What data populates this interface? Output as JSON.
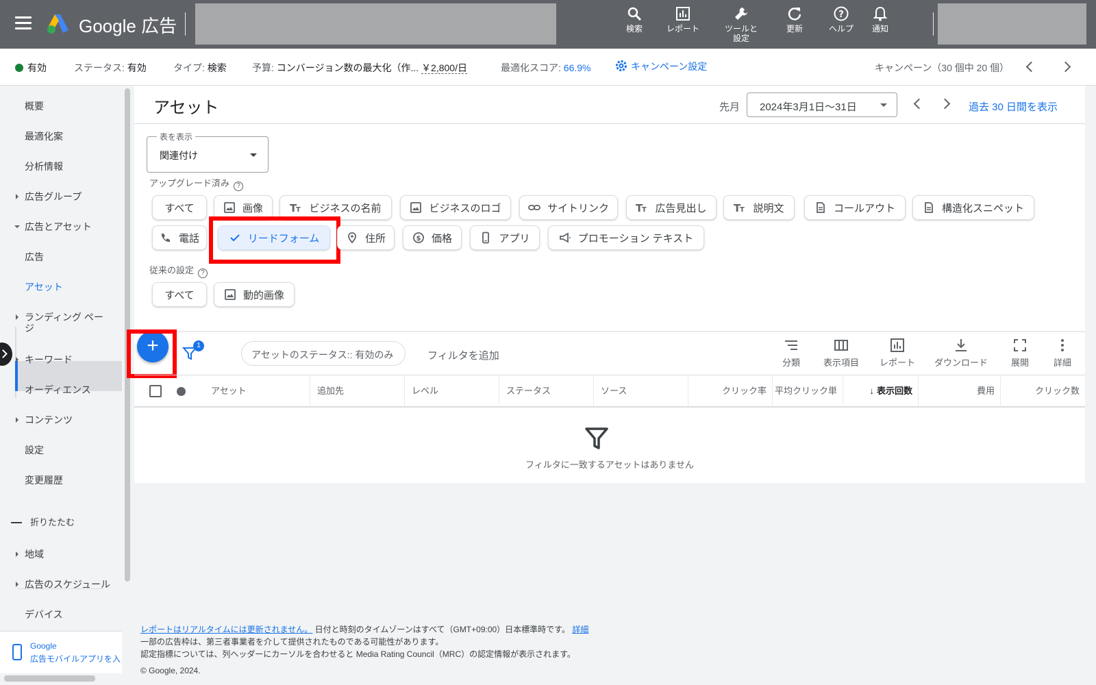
{
  "topbar": {
    "brand": "Google 広告",
    "buttons": [
      {
        "label": "検索",
        "icon": "search-icon"
      },
      {
        "label": "レポート",
        "icon": "report-icon"
      },
      {
        "label": "ツールと",
        "label2": "設定",
        "icon": "wrench-icon"
      },
      {
        "label": "更新",
        "icon": "refresh-icon"
      },
      {
        "label": "ヘルプ",
        "icon": "help-icon"
      },
      {
        "label": "通知",
        "icon": "bell-icon"
      }
    ]
  },
  "summary": {
    "status": "有効",
    "status_label": "ステータス: ",
    "status_value": "有効",
    "type_label": "タイプ: ",
    "type_value": "検索",
    "budget_label": "予算: ",
    "budget_value": "コンバージョン数の最大化（作...",
    "budget_amount": "￥2,800/日",
    "opt_label": "最適化スコア: ",
    "opt_value": "66.9%",
    "campaign_settings": "キャンペーン設定",
    "campaign_count": "キャンペーン（30 個中 20 個）"
  },
  "sidebar": {
    "items": [
      "概要",
      "最適化案",
      "分析情報",
      "広告グループ",
      "広告とアセット",
      "広告",
      "アセット",
      "ランディング ペー",
      "ジ",
      "キーワード",
      "オーディエンス",
      "コンテンツ",
      "設定",
      "変更履歴",
      "折りたたむ",
      "地域",
      "広告のスケジュール",
      "デバイス"
    ],
    "mobile_app_line1": "Google",
    "mobile_app_line2": "広告モバイルアプリを入"
  },
  "main": {
    "title": "アセット",
    "date_label": "先月",
    "date_range": "2024年3月1日〜31日",
    "last30": "過去 30 日間を表示",
    "view_label": "表を表示",
    "view_value": "関連付け",
    "upgraded_label": "アップグレード済み",
    "legacy_label": "従来の設定",
    "chips_row1": [
      "すべて",
      "画像",
      "ビジネスの名前",
      "ビジネスのロゴ",
      "サイトリンク",
      "広告見出し",
      "説明文",
      "コールアウト",
      "構造化スニペット"
    ],
    "chips_row2": [
      "電話",
      "リードフォーム",
      "住所",
      "価格",
      "アプリ",
      "プロモーション テキスト"
    ],
    "chips_row3": [
      "すべて",
      "動的画像"
    ],
    "filter_badge": "1",
    "status_filter": "アセットのステータス:: 有効のみ",
    "add_filter": "フィルタを追加",
    "tools": [
      "分類",
      "表示項目",
      "レポート",
      "ダウンロード",
      "展開",
      "詳細"
    ],
    "columns": [
      "アセット",
      "追加先",
      "レベル",
      "ステータス",
      "ソース",
      "クリック率",
      "平均クリック単",
      "表示回数",
      "費用",
      "クリック数"
    ],
    "empty_text": "フィルタに一致するアセットはありません"
  },
  "footer": {
    "line1_link": "レポートはリアルタイムには更新されません。",
    "line1_text": "日付と時刻のタイムゾーンはすべて（GMT+09:00）日本標準時です。",
    "line1_more": "詳細",
    "line2": "一部の広告枠は、第三者事業者を介して提供されたものである可能性があります。",
    "line3": "認定指標については、列ヘッダーにカーソルを合わせると Media Rating Council（MRC）の認定情報が表示されます。",
    "copyright": "© Google, 2024."
  }
}
